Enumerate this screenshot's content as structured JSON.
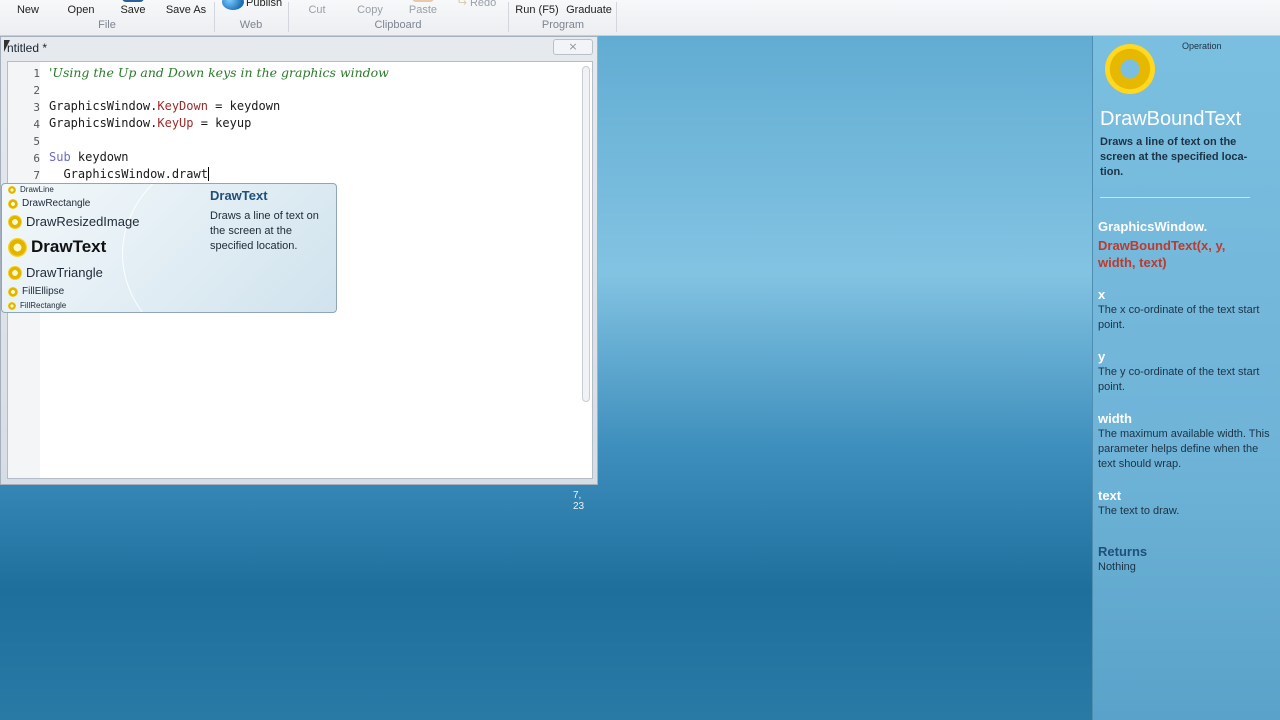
{
  "toolbar": {
    "buttons": [
      {
        "label": "New",
        "enabled": true
      },
      {
        "label": "Open",
        "enabled": true
      },
      {
        "label": "Save",
        "enabled": true
      },
      {
        "label": "Save As",
        "enabled": true
      },
      {
        "label": "Publish",
        "enabled": true
      },
      {
        "label": "Cut",
        "enabled": false
      },
      {
        "label": "Copy",
        "enabled": false
      },
      {
        "label": "Paste",
        "enabled": false
      },
      {
        "label": "Redo",
        "enabled": false
      },
      {
        "label": "Run (F5)",
        "enabled": true
      },
      {
        "label": "Graduate",
        "enabled": true
      }
    ],
    "groups": [
      "File",
      "Web",
      "Clipboard",
      "Program"
    ]
  },
  "editor": {
    "title": "ntitled *",
    "close_label": "×",
    "cursor_position": "7, 23",
    "lines": [
      {
        "num": "1",
        "comment": "'Using the Up and Down keys in the graphics window"
      },
      {
        "num": "2"
      },
      {
        "num": "3",
        "obj": "GraphicsWindow.",
        "prop": "KeyDown",
        "rest": " = keydown"
      },
      {
        "num": "4",
        "obj": "GraphicsWindow.",
        "prop": "KeyUp",
        "rest": " = keyup"
      },
      {
        "num": "5"
      },
      {
        "num": "6",
        "kw": "Sub",
        "rest": " keydown"
      },
      {
        "num": "7",
        "indent": "  ",
        "rest": "GraphicsWindow.drawt"
      }
    ]
  },
  "intellisense": {
    "items": [
      "DrawLine",
      "DrawRectangle",
      "DrawResizedImage",
      "DrawText",
      "DrawTriangle",
      "FillEllipse",
      "FillRectangle"
    ],
    "selected": "DrawText",
    "detail_title": "DrawText",
    "detail_desc": "Draws a line of text on the screen at the specified location."
  },
  "help": {
    "kind": "Operation",
    "name": "DrawBoundText",
    "short_desc": "Draws a line of text on the screen at the specified loca-tion.",
    "sig_object": "GraphicsWindow.",
    "sig_method": "DrawBoundText(x, y, width, text)",
    "params": [
      {
        "name": "x",
        "desc": "The x co-ordinate of the text start point."
      },
      {
        "name": "y",
        "desc": "The y co-ordinate of the text start point."
      },
      {
        "name": "width",
        "desc": "The maximum available width. This parameter helps define when the text should wrap."
      },
      {
        "name": "text",
        "desc": "The text to draw."
      }
    ],
    "returns_label": "Returns",
    "returns_value": "Nothing"
  }
}
